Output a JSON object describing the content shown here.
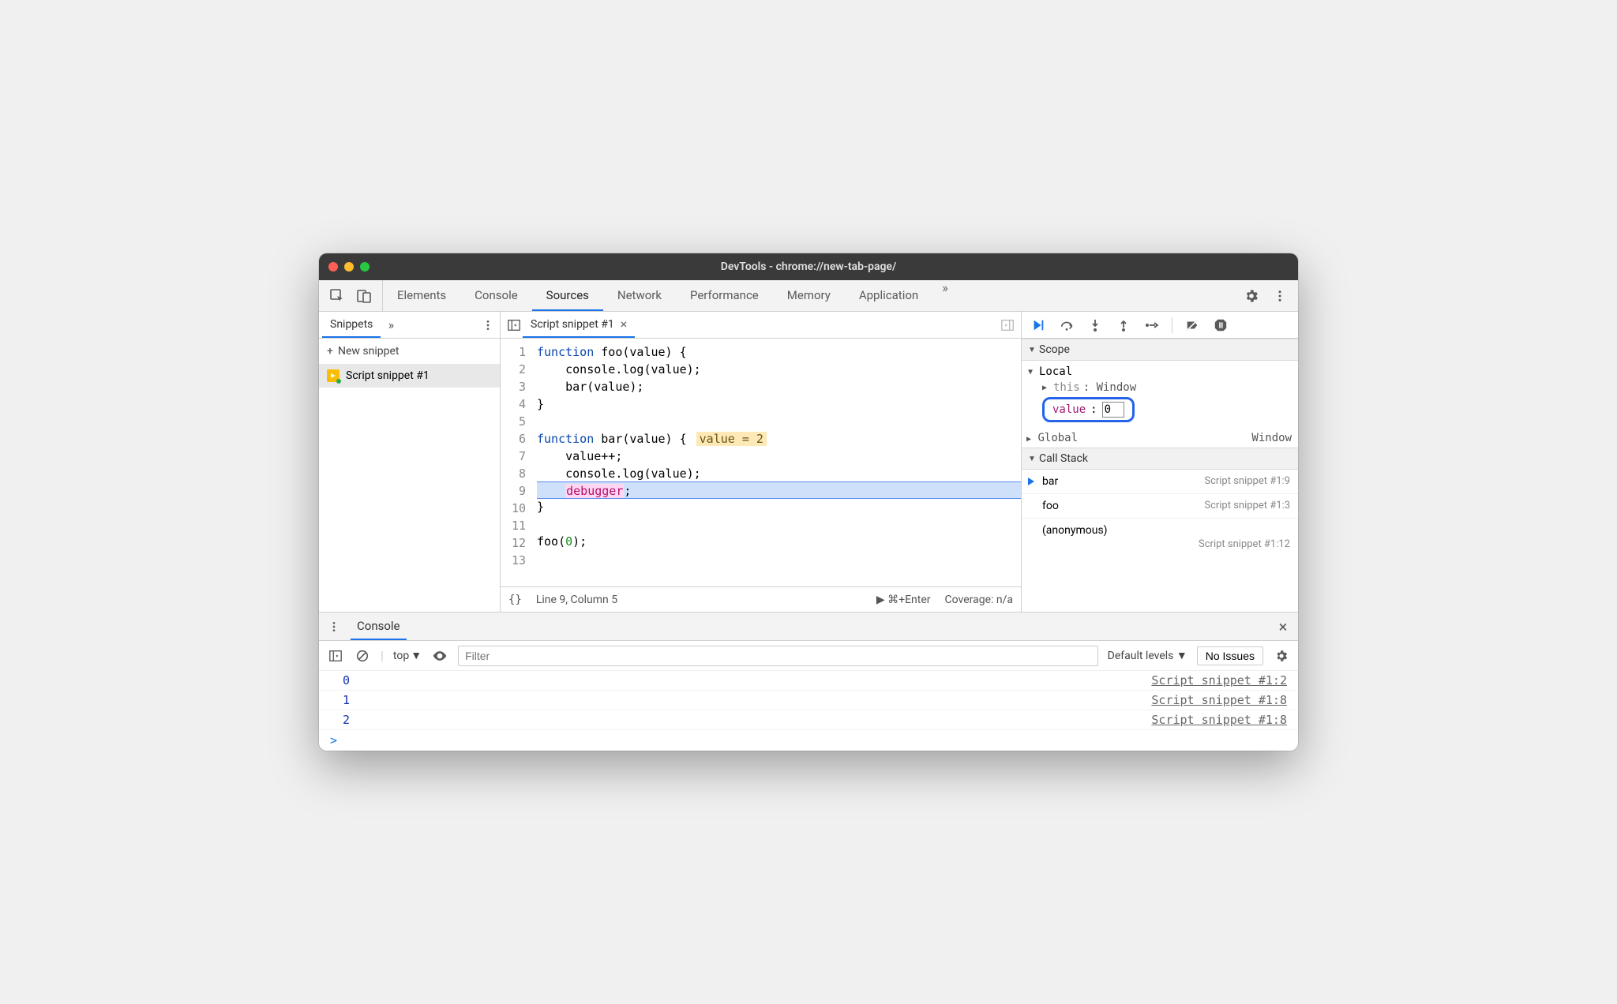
{
  "titlebar": {
    "title": "DevTools - chrome://new-tab-page/"
  },
  "tabs": {
    "items": [
      "Elements",
      "Console",
      "Sources",
      "Network",
      "Performance",
      "Memory",
      "Application"
    ],
    "overflow": "»"
  },
  "sidebar": {
    "tab": "Snippets",
    "overflow": "»",
    "new_snippet": "New snippet",
    "items": [
      {
        "label": "Script snippet #1"
      }
    ]
  },
  "editor": {
    "filetab": "Script snippet #1",
    "lines": 13,
    "code": {
      "l1_kw": "function",
      "l1_rest": " foo(value) {",
      "l2": "    console.log(value);",
      "l3": "    bar(value);",
      "l4": "}",
      "l5": "",
      "l6_kw": "function",
      "l6_rest": " bar(value) {",
      "l6_anno": "value = 2",
      "l7": "    value++;",
      "l8": "    console.log(value);",
      "l9_indent": "    ",
      "l9_dbg": "debugger",
      "l9_semi": ";",
      "l10": "}",
      "l11": "",
      "l12_a": "foo(",
      "l12_num": "0",
      "l12_b": ");",
      "l13": ""
    },
    "status": {
      "braces": "{}",
      "pos": "Line 9, Column 5",
      "run": "⌘+Enter",
      "coverage": "Coverage: n/a"
    }
  },
  "debugger": {
    "scope_header": "Scope",
    "local": {
      "label": "Local",
      "this_key": "this",
      "this_val": ": Window",
      "value_key": "value",
      "value_edit": "0"
    },
    "global": {
      "label": "Global",
      "val": "Window"
    },
    "callstack_header": "Call Stack",
    "frames": [
      {
        "fn": "bar",
        "loc": "Script snippet #1:9",
        "current": true
      },
      {
        "fn": "foo",
        "loc": "Script snippet #1:3",
        "current": false
      }
    ],
    "anon": {
      "fn": "(anonymous)",
      "loc": "Script snippet #1:12"
    }
  },
  "drawer": {
    "tab": "Console",
    "context": "top",
    "filter_placeholder": "Filter",
    "levels": "Default levels",
    "issues": "No Issues",
    "rows": [
      {
        "out": "0",
        "src": "Script snippet #1:2"
      },
      {
        "out": "1",
        "src": "Script snippet #1:8"
      },
      {
        "out": "2",
        "src": "Script snippet #1:8"
      }
    ],
    "prompt": ">"
  }
}
